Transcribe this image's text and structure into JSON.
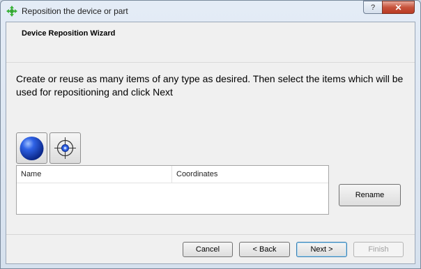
{
  "window": {
    "title": "Reposition the device or part",
    "help_label": "?",
    "close_label": "✕"
  },
  "wizard": {
    "title": "Device Reposition Wizard",
    "instructions": "Create or reuse as many items of any type as desired. Then select the items which will be used for repositioning and click Next"
  },
  "toolbar": {
    "icons": [
      "sphere-icon",
      "target-crosshair-icon"
    ]
  },
  "table": {
    "columns": [
      "Name",
      "Coordinates"
    ],
    "rows": []
  },
  "buttons": {
    "rename": "Rename",
    "cancel": "Cancel",
    "back": "< Back",
    "next": "Next >",
    "finish": "Finish"
  },
  "colors": {
    "accent": "#3c7fb1",
    "close": "#c7533c",
    "sphere": "#1f4fd6"
  }
}
